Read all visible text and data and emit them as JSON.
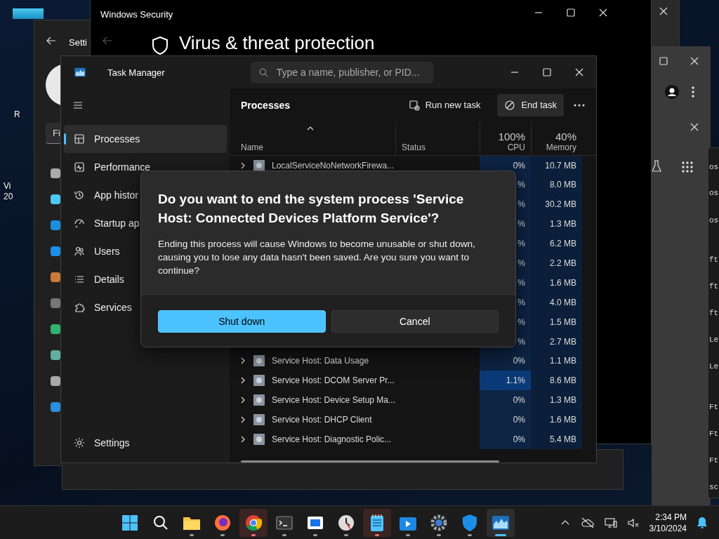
{
  "desktop": {
    "labels": [
      "R",
      "Vi",
      "20"
    ]
  },
  "settings_window": {
    "title": "Setti",
    "search_value": "Fi"
  },
  "security_window": {
    "title": "Windows Security",
    "heading": "Virus & threat protection"
  },
  "side_window": {
    "fragments": [
      "os",
      "os",
      "os",
      "ft",
      "ft",
      "ft",
      "Le",
      "Le",
      "Ft",
      "Ft",
      "Ft",
      "sc"
    ]
  },
  "task_manager": {
    "title": "Task Manager",
    "search": {
      "placeholder": "Type a name, publisher, or PID..."
    },
    "nav": [
      {
        "label": "Processes",
        "kind": "processes",
        "selected": true
      },
      {
        "label": "Performance",
        "kind": "performance",
        "selected": false
      },
      {
        "label": "App histor",
        "kind": "history",
        "selected": false
      },
      {
        "label": "Startup ap",
        "kind": "startup",
        "selected": false
      },
      {
        "label": "Users",
        "kind": "users",
        "selected": false
      },
      {
        "label": "Details",
        "kind": "details",
        "selected": false
      },
      {
        "label": "Services",
        "kind": "services",
        "selected": false
      }
    ],
    "settings_label": "Settings",
    "page_title": "Processes",
    "run_new_task": "Run new task",
    "end_task": "End task",
    "columns": {
      "name": "Name",
      "status": "Status",
      "cpu_total": "100%",
      "cpu": "CPU",
      "memory_total": "40%",
      "memory": "Memory"
    },
    "rows": [
      {
        "name": "LocalServiceNoNetworkFirewa...",
        "cpu": "0%",
        "memory": "10.7 MB",
        "hot": false
      },
      {
        "cpu": "%",
        "memory": "8.0 MB",
        "hot": false
      },
      {
        "cpu": "%",
        "memory": "30.2 MB",
        "hot": false
      },
      {
        "cpu": "%",
        "memory": "1.3 MB",
        "hot": false
      },
      {
        "cpu": "%",
        "memory": "6.2 MB",
        "hot": false
      },
      {
        "cpu": "%",
        "memory": "2.2 MB",
        "hot": false
      },
      {
        "cpu": "%",
        "memory": "1.6 MB",
        "hot": false
      },
      {
        "cpu": "%",
        "memory": "4.0 MB",
        "hot": false
      },
      {
        "cpu": "%",
        "memory": "1.5 MB",
        "hot": false
      },
      {
        "cpu": "%",
        "memory": "2.7 MB",
        "hot": false
      },
      {
        "name": "Service Host: Data Usage",
        "cpu": "0%",
        "memory": "1.1 MB",
        "hot": false
      },
      {
        "name": "Service Host: DCOM Server Pr...",
        "cpu": "1.1%",
        "memory": "8.6 MB",
        "hot": true
      },
      {
        "name": "Service Host: Device Setup Ma...",
        "cpu": "0%",
        "memory": "1.3 MB",
        "hot": false
      },
      {
        "name": "Service Host: DHCP Client",
        "cpu": "0%",
        "memory": "1.6 MB",
        "hot": false
      },
      {
        "name": "Service Host: Diagnostic Polic...",
        "cpu": "0%",
        "memory": "5.4 MB",
        "hot": false
      }
    ]
  },
  "dialog": {
    "title": "Do you want to end the system process 'Service Host: Connected Devices Platform Service'?",
    "message": "Ending this process will cause Windows to become unusable or shut down, causing you to lose any data hasn't been saved. Are you sure you want to continue?",
    "primary": "Shut down",
    "secondary": "Cancel"
  },
  "taskbar": {
    "apps": [
      {
        "kind": "start",
        "running": false,
        "attention": false,
        "selected": false
      },
      {
        "kind": "search",
        "running": false,
        "attention": false,
        "selected": false
      },
      {
        "kind": "explorer",
        "running": true,
        "attention": false,
        "selected": false
      },
      {
        "kind": "firefox",
        "running": true,
        "attention": false,
        "selected": false
      },
      {
        "kind": "chrome",
        "running": true,
        "attention": true,
        "selected": false
      },
      {
        "kind": "terminal",
        "running": true,
        "attention": false,
        "selected": false
      },
      {
        "kind": "window",
        "running": true,
        "attention": false,
        "selected": false
      },
      {
        "kind": "clock",
        "running": true,
        "attention": false,
        "selected": false
      },
      {
        "kind": "notepad",
        "running": true,
        "attention": true,
        "selected": false
      },
      {
        "kind": "media",
        "running": true,
        "attention": false,
        "selected": false
      },
      {
        "kind": "settings",
        "running": true,
        "attention": false,
        "selected": false
      },
      {
        "kind": "defender",
        "running": true,
        "attention": false,
        "selected": false
      },
      {
        "kind": "taskmgr",
        "running": true,
        "attention": false,
        "selected": true
      }
    ],
    "time": "2:34 PM",
    "date": "3/10/2024"
  }
}
